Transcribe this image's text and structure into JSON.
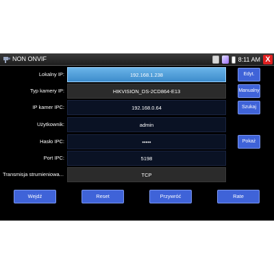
{
  "titlebar": {
    "title": "NON ONVIF",
    "time": "8:11 AM",
    "icons": [
      "app-icon",
      "sim-card-icon",
      "network-icon",
      "battery-icon",
      "close-icon"
    ],
    "close_label": "X"
  },
  "form": {
    "fields": [
      {
        "label": "Lokalny IP:",
        "value": "192.168.1.238"
      },
      {
        "label": "Typ kamery IP:",
        "value": "HIKVISION_DS-2CD864-E13"
      },
      {
        "label": "IP kamer IPC:",
        "value": "192.168.0.64"
      },
      {
        "label": "Użytkownik:",
        "value": "admin"
      },
      {
        "label": "Hasło IPC:",
        "value": "•••••"
      },
      {
        "label": "Port IPC:",
        "value": "5198"
      },
      {
        "label": "Transmisja strumieniowa...",
        "value": "TCP"
      }
    ]
  },
  "side_buttons": {
    "edit": "Edyt.",
    "manual": "Manualny",
    "search": "Szukaj",
    "show": "Pokaż"
  },
  "bottom_buttons": {
    "enter": "Wejdź",
    "reset": "Reset",
    "restore": "Przywróć",
    "rate": "Rate"
  },
  "colors": {
    "accent_button": "#3f63d8",
    "selected_field": "#4f9ed8",
    "close_button": "#e02020",
    "background": "#000000"
  }
}
